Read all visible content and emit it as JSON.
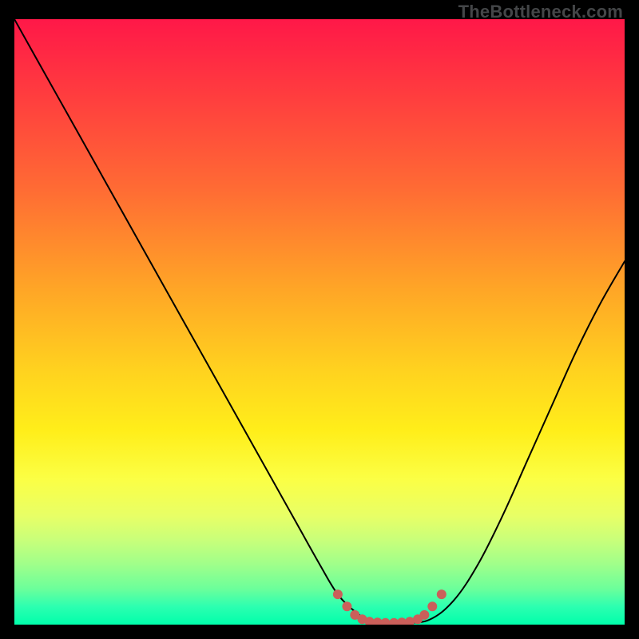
{
  "attribution": "TheBottleneck.com",
  "colors": {
    "frame_bg": "#000000",
    "gradient_top": "#ff1848",
    "gradient_mid": "#ffd21f",
    "gradient_bottom": "#00ffab",
    "curve_stroke": "#000000",
    "dot_fill": "#cb5f5a"
  },
  "chart_data": {
    "type": "line",
    "title": "",
    "xlabel": "",
    "ylabel": "",
    "xlim": [
      0,
      100
    ],
    "ylim": [
      0,
      100
    ],
    "grid": false,
    "legend": false,
    "series": [
      {
        "name": "bottleneck-curve",
        "x": [
          0,
          5,
          10,
          15,
          20,
          25,
          30,
          35,
          40,
          45,
          50,
          53,
          56,
          58,
          60,
          62,
          64,
          68,
          72,
          76,
          80,
          84,
          88,
          92,
          96,
          100
        ],
        "y": [
          100,
          91,
          82,
          73,
          64,
          55,
          46,
          37,
          28,
          19,
          10,
          5,
          2,
          0.8,
          0.4,
          0.3,
          0.3,
          0.8,
          4,
          10,
          18,
          27,
          36,
          45,
          53,
          60
        ]
      }
    ],
    "markers": [
      {
        "name": "bottom-dots",
        "color": "#cb5f5a",
        "points": [
          {
            "x": 53.0,
            "y": 5.0
          },
          {
            "x": 54.5,
            "y": 3.0
          },
          {
            "x": 55.8,
            "y": 1.6
          },
          {
            "x": 57.0,
            "y": 0.9
          },
          {
            "x": 58.2,
            "y": 0.5
          },
          {
            "x": 59.5,
            "y": 0.35
          },
          {
            "x": 60.8,
            "y": 0.3
          },
          {
            "x": 62.2,
            "y": 0.3
          },
          {
            "x": 63.5,
            "y": 0.35
          },
          {
            "x": 64.8,
            "y": 0.5
          },
          {
            "x": 66.1,
            "y": 0.9
          },
          {
            "x": 67.2,
            "y": 1.6
          },
          {
            "x": 68.5,
            "y": 3.0
          },
          {
            "x": 70.0,
            "y": 5.0
          }
        ]
      }
    ]
  }
}
